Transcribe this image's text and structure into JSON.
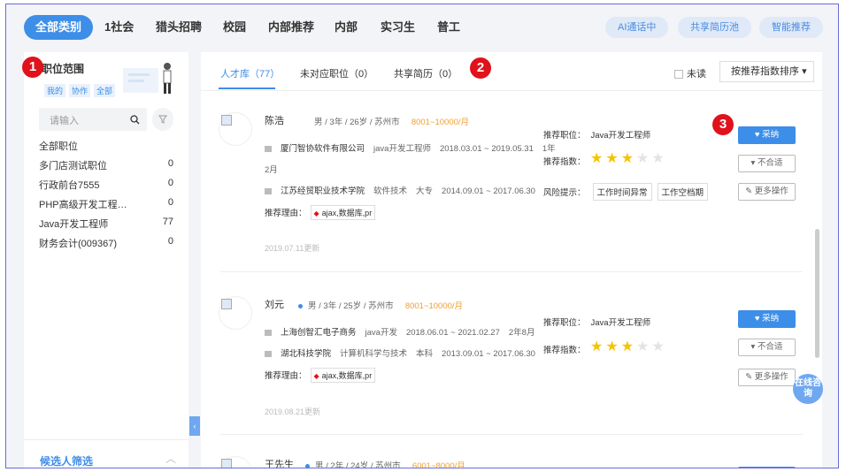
{
  "nav": {
    "categories": [
      "全部类别",
      "1社会",
      "猎头招聘",
      "校园",
      "内部推荐",
      "内部",
      "实习生",
      "普工"
    ],
    "pills": [
      "AI通话中",
      "共享简历池",
      "智能推荐"
    ]
  },
  "annotations": [
    "1",
    "2",
    "3"
  ],
  "sidebar": {
    "title": "职位范围",
    "scope": [
      "我的",
      "协作",
      "全部"
    ],
    "search_placeholder": "请输入",
    "list_header": "全部职位",
    "positions": [
      {
        "name": "多门店测试职位",
        "count": "0"
      },
      {
        "name": "行政前台7555",
        "count": "0"
      },
      {
        "name": "PHP高级开发工程…",
        "count": "0"
      },
      {
        "name": "Java开发工程师",
        "count": "77"
      },
      {
        "name": "财务会计(009367)",
        "count": "0"
      }
    ],
    "bottom_label": "候选人筛选"
  },
  "main": {
    "tabs": [
      "人才库（77）",
      "未对应职位（0）",
      "共享简历（0）"
    ],
    "unread_label": "未读",
    "sort_label": "按推荐指数排序"
  },
  "candidates": [
    {
      "name": "陈浩",
      "meta": "男 / 3年 / 26岁 / 苏州市",
      "salary": "8001~10000/月",
      "work": "厦门智协软件有限公司",
      "work_role": "java开发工程师",
      "work_period": "2018.03.01 ~ 2019.05.31",
      "work_duration_a": "1年",
      "work_duration_b": "2月",
      "school": "江苏经贸职业技术学院",
      "major": "软件技术",
      "degree": "大专",
      "school_period": "2014.09.01 ~ 2017.06.30",
      "reason_label": "推荐理由：",
      "reason_tag": "ajax,数据库,pr",
      "date": "2019.07.11更新",
      "rec_pos_label": "推荐职位：",
      "rec_pos": "Java开发工程师",
      "index_label": "推荐指数：",
      "rating": 3,
      "risk_label": "风险提示：",
      "risks": [
        "工作时间异常",
        "工作空档期"
      ],
      "accept": "采纳",
      "reject": "不合适",
      "more": "更多操作"
    },
    {
      "name": "刘元",
      "meta": "男 / 3年 / 25岁 / 苏州市",
      "salary": "8001~10000/月",
      "work": "上海创智汇电子商务",
      "work_role": "java开发",
      "work_period": "2018.06.01 ~ 2021.02.27",
      "work_duration_a": "2年8月",
      "school": "湖北科技学院",
      "major": "计算机科学与技术",
      "degree": "本科",
      "school_period": "2013.09.01 ~ 2017.06.30",
      "reason_label": "推荐理由：",
      "reason_tag": "ajax,数据库,pr",
      "date": "2019.08.21更新",
      "rec_pos_label": "推荐职位：",
      "rec_pos": "Java开发工程师",
      "index_label": "推荐指数：",
      "rating": 3,
      "accept": "采纳",
      "reject": "不合适",
      "more": "更多操作"
    },
    {
      "name": "王先生",
      "meta": "男 / 2年 / 24岁 / 苏州市",
      "salary": "6001~8000/月"
    }
  ],
  "consult_label": "在线咨询",
  "colors": {
    "accent": "#3d8ee8",
    "badge": "#e0121c",
    "salary": "#f0a030",
    "star": "#f5c400"
  }
}
